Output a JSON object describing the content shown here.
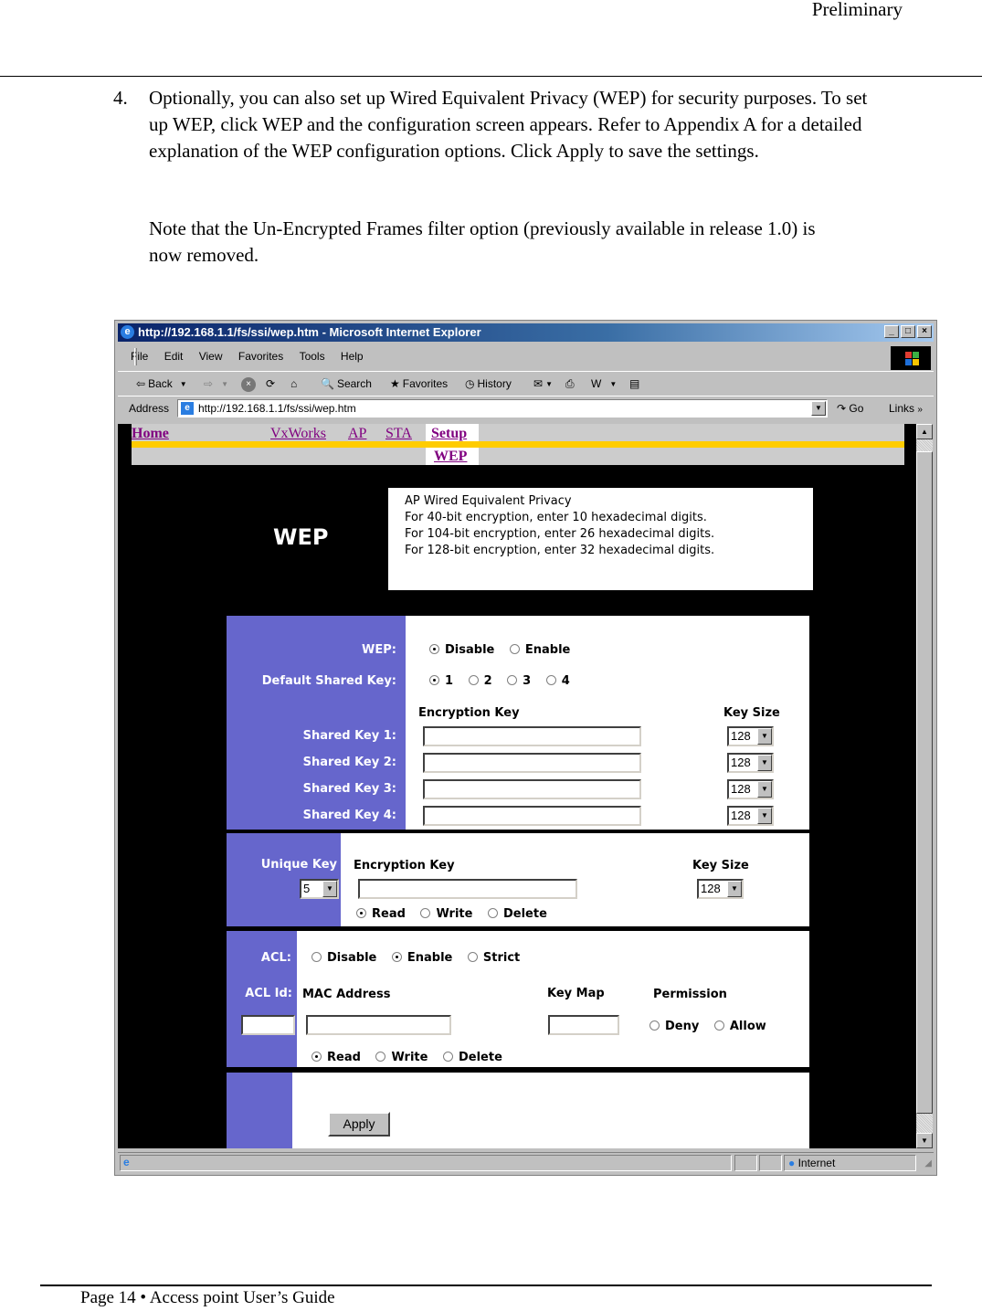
{
  "doc": {
    "header_label": "Preliminary",
    "step_number": "4.",
    "paragraph1": "Optionally, you can also set up Wired Equivalent Privacy (WEP) for security purposes.  To set up WEP, click WEP and the configuration screen appears. Refer to Appendix A for a detailed explanation of the WEP configuration options. Click Apply to save the settings.",
    "paragraph2": "Note that the Un-Encrypted Frames filter option (previously available in release 1.0) is now removed.",
    "footer": "Page 14 •   Access point User’s Guide"
  },
  "browser": {
    "title": "http://192.168.1.1/fs/ssi/wep.htm - Microsoft Internet Explorer",
    "menu": [
      "File",
      "Edit",
      "View",
      "Favorites",
      "Tools",
      "Help"
    ],
    "toolbar": {
      "back": "Back",
      "search": "Search",
      "favorites": "Favorites",
      "history": "History"
    },
    "address_label": "Address",
    "address_value": "http://192.168.1.1/fs/ssi/wep.htm",
    "go_label": "Go",
    "links_label": "Links",
    "status_zone": "Internet"
  },
  "page": {
    "nav": {
      "home": "Home",
      "items": [
        "VxWorks",
        "AP",
        "STA",
        "Setup"
      ],
      "selected": "Setup",
      "sub_item": "WEP"
    },
    "title": "WEP",
    "info_lines": [
      "AP Wired Equivalent Privacy",
      "For 40-bit encryption, enter 10 hexadecimal digits.",
      "For 104-bit encryption, enter 26 hexadecimal digits.",
      "For 128-bit encryption, enter 32 hexadecimal digits."
    ],
    "wep": {
      "label": "WEP:",
      "options": [
        "Disable",
        "Enable"
      ],
      "selected": "Disable",
      "default_key_label": "Default Shared Key:",
      "default_key_options": [
        "1",
        "2",
        "3",
        "4"
      ],
      "default_key_selected": "1",
      "col_encryption_key": "Encryption Key",
      "col_key_size": "Key Size",
      "shared_keys": [
        {
          "label": "Shared Key 1:",
          "value": "",
          "size": "128"
        },
        {
          "label": "Shared Key 2:",
          "value": "",
          "size": "128"
        },
        {
          "label": "Shared Key 3:",
          "value": "",
          "size": "128"
        },
        {
          "label": "Shared Key 4:",
          "value": "",
          "size": "128"
        }
      ]
    },
    "unique": {
      "label": "Unique Key",
      "key_index": "5",
      "col_encryption_key": "Encryption Key",
      "col_key_size": "Key Size",
      "value": "",
      "size": "128",
      "actions": [
        "Read",
        "Write",
        "Delete"
      ],
      "action_selected": "Read"
    },
    "acl": {
      "label": "ACL:",
      "options": [
        "Disable",
        "Enable",
        "Strict"
      ],
      "selected": "Enable",
      "id_label": "ACL Id:",
      "id_value": "",
      "col_mac": "MAC Address",
      "mac_value": "",
      "col_keymap": "Key Map",
      "keymap_value": "",
      "col_permission": "Permission",
      "permission_options": [
        "Deny",
        "Allow"
      ],
      "permission_selected": "",
      "actions": [
        "Read",
        "Write",
        "Delete"
      ],
      "action_selected": "Read"
    },
    "apply_label": "Apply"
  },
  "colors": {
    "label_panel": "#6666cc",
    "nav_gold": "#ffcc00",
    "link": "#800080"
  }
}
